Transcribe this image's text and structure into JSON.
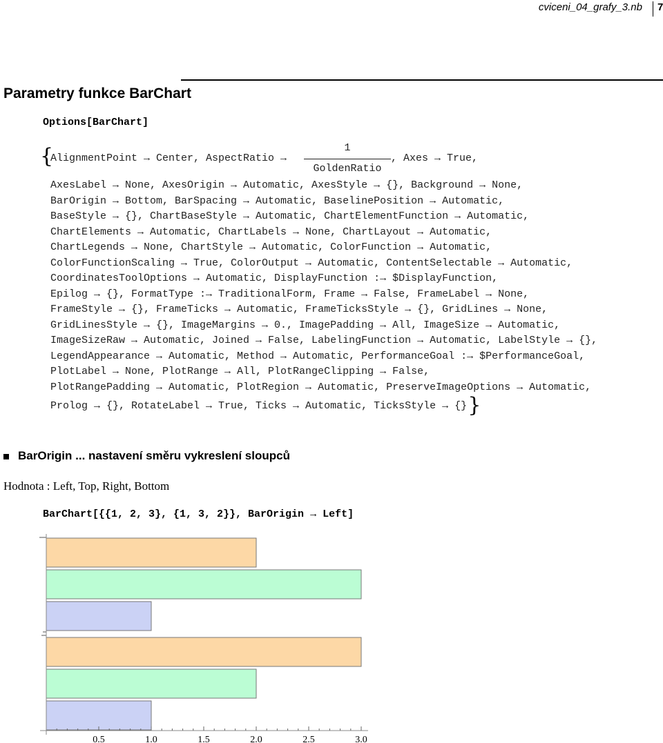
{
  "header": {
    "filename": "cviceni_04_grafy_3.nb",
    "page": "7"
  },
  "section_title": "Parametry funkce BarChart",
  "input1": "Options[BarChart]",
  "output1": {
    "first_line": "AlignmentPoint → Center, AspectRatio →",
    "fraction_num": "1",
    "fraction_den": "GoldenRatio",
    "first_line_end": ", Axes → True,",
    "lines": [
      "AxesLabel → None, AxesOrigin → Automatic, AxesStyle → {}, Background → None,",
      "BarOrigin → Bottom, BarSpacing → Automatic, BaselinePosition → Automatic,",
      "BaseStyle → {}, ChartBaseStyle → Automatic, ChartElementFunction → Automatic,",
      "ChartElements → Automatic, ChartLabels → None, ChartLayout → Automatic,",
      "ChartLegends → None, ChartStyle → Automatic, ColorFunction → Automatic,",
      "ColorFunctionScaling → True, ColorOutput → Automatic, ContentSelectable → Automatic,",
      "CoordinatesToolOptions → Automatic, DisplayFunction :→ $DisplayFunction,",
      "Epilog → {}, FormatType :→ TraditionalForm, Frame → False, FrameLabel → None,",
      "FrameStyle → {}, FrameTicks → Automatic, FrameTicksStyle → {}, GridLines → None,",
      "GridLinesStyle → {}, ImageMargins → 0., ImagePadding → All, ImageSize → Automatic,",
      "ImageSizeRaw → Automatic, Joined → False, LabelingFunction → Automatic, LabelStyle → {},",
      "LegendAppearance → Automatic, Method → Automatic, PerformanceGoal :→ $PerformanceGoal,",
      "PlotLabel → None, PlotRange → All, PlotRangeClipping → False,",
      "PlotRangePadding → Automatic, PlotRegion → Automatic, PreserveImageOptions → Automatic,",
      "Prolog → {}, RotateLabel → True, Ticks → Automatic, TicksStyle → {}"
    ]
  },
  "subsection": "BarOrigin ... nastavení směru vykreslení sloupců",
  "values_text": "Hodnota : Left, Top, Right, Bottom",
  "input2": "BarChart[{{1, 2, 3}, {1, 3, 2}}, BarOrigin → Left]",
  "chart_data": {
    "type": "bar",
    "orientation": "horizontal",
    "bar_origin": "Left",
    "groups": [
      [
        1,
        2,
        3
      ],
      [
        1,
        3,
        2
      ]
    ],
    "colors": [
      "#cbd2f5",
      "#bbfdd4",
      "#fdd8a6"
    ],
    "xlim": [
      0,
      3
    ],
    "x_ticks": [
      "0.5",
      "1.0",
      "1.5",
      "2.0",
      "2.5",
      "3.0"
    ],
    "grid": false
  }
}
